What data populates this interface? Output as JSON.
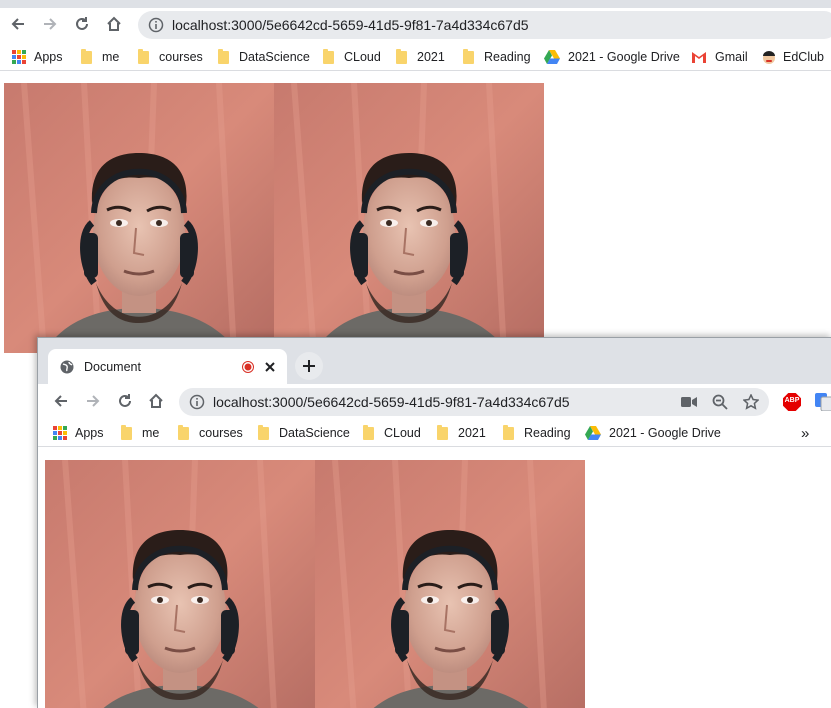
{
  "back_window": {
    "url": "localhost:3000/5e6642cd-5659-41d5-9f81-7a4d334c67d5",
    "bookmarks": [
      "Apps",
      "me",
      "courses",
      "DataScience",
      "CLoud",
      "2021",
      "Reading",
      "2021 - Google Drive",
      "Gmail",
      "EdClub"
    ]
  },
  "front_window": {
    "tab_title": "Document",
    "url": "localhost:3000/5e6642cd-5659-41d5-9f81-7a4d334c67d5",
    "bookmarks": [
      "Apps",
      "me",
      "courses",
      "DataScience",
      "CLoud",
      "2021",
      "Reading",
      "2021 - Google Drive"
    ],
    "abp_label": "ABP",
    "overflow_label": "»"
  },
  "colors": {
    "chrome_frame": "#dee1e6",
    "omnibox_bg": "#e8eaed",
    "folder": "#f9d46b",
    "recording": "#d93025",
    "wall": "#c97b6f"
  },
  "icons": [
    "back-icon",
    "forward-icon",
    "reload-icon",
    "home-icon",
    "info-icon",
    "camera-icon",
    "zoom-icon",
    "star-icon",
    "adblock-icon",
    "translate-icon",
    "globe-icon",
    "record-icon",
    "close-icon",
    "plus-icon",
    "apps-icon",
    "folder-icon",
    "drive-icon",
    "gmail-icon",
    "edclub-icon"
  ]
}
